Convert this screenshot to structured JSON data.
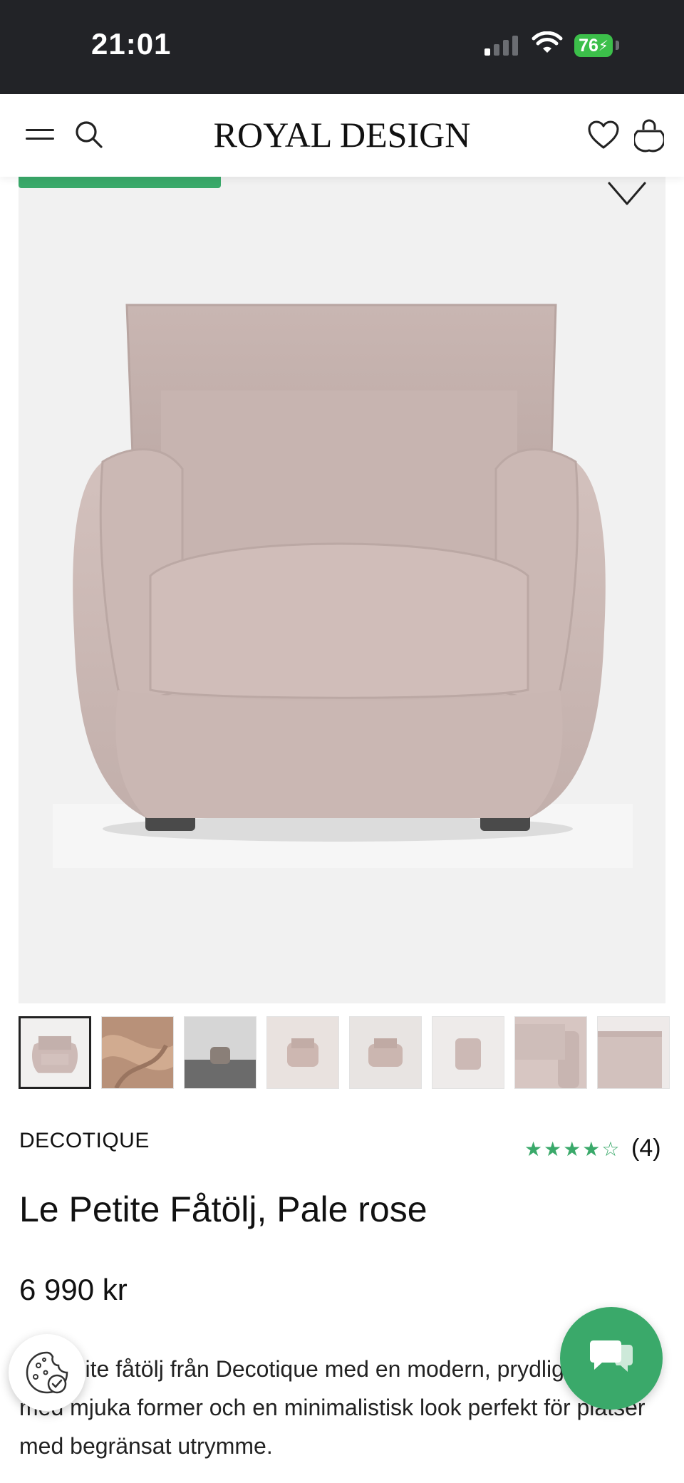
{
  "status_bar": {
    "time": "21:01",
    "battery": "76"
  },
  "header": {
    "logo": "ROYAL DESIGN"
  },
  "product": {
    "brand": "DECOTIQUE",
    "rating": {
      "stars_filled": 4,
      "stars_total": 5,
      "count": "(4)"
    },
    "title": "Le Petite Fåtölj, Pale rose",
    "price": "6 990 kr",
    "description": "Le Petite fåtölj från Decotique med en modern, prydlig design med mjuka former och en minimalistisk look perfekt för platser med begränsat utrymme."
  },
  "gallery": {
    "thumbnail_count": 8,
    "active_index": 0,
    "chair_color": "#cdbab6"
  },
  "colors": {
    "accent": "#3aa96a",
    "status_bar": "#222327"
  },
  "icons": [
    "menu-icon",
    "search-icon",
    "heart-icon",
    "bag-icon",
    "wishlist-heart-icon",
    "cookie-icon",
    "chat-icon"
  ]
}
